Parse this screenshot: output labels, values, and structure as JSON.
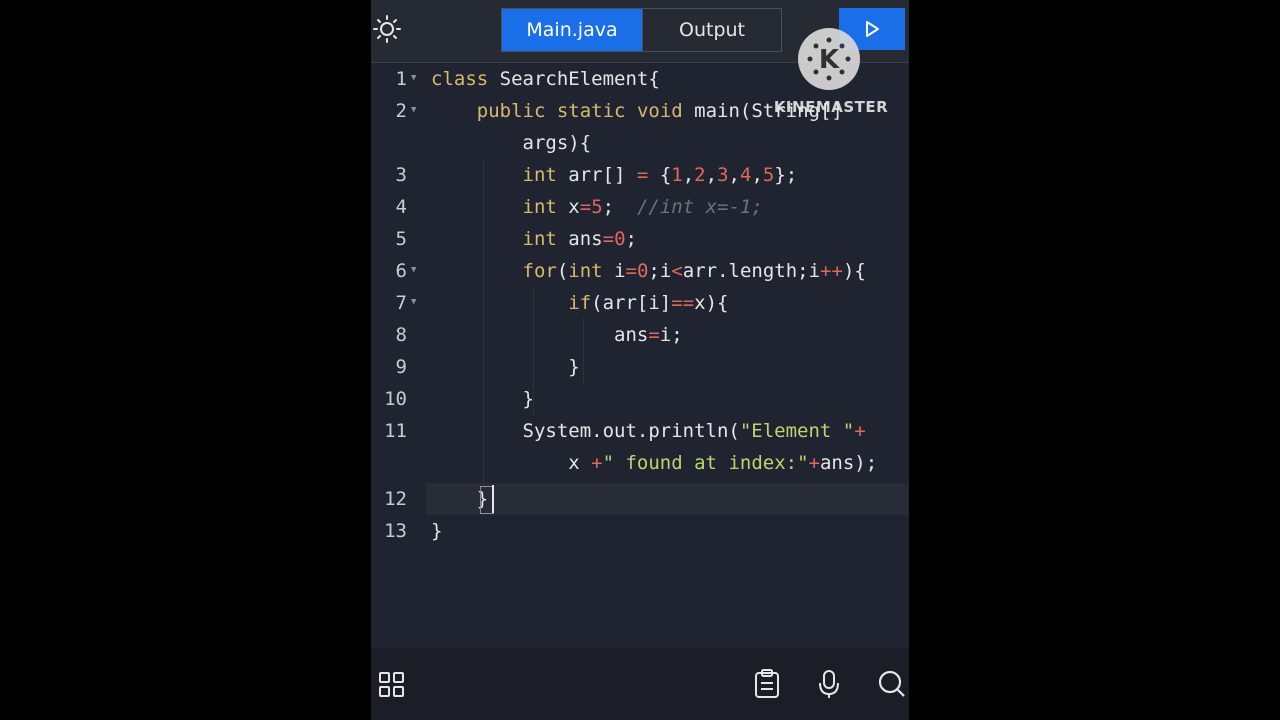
{
  "tabs": [
    {
      "label": "Main.java",
      "active": true
    },
    {
      "label": "Output",
      "active": false
    }
  ],
  "toolbar": {
    "theme_icon": "sun-icon",
    "run_icon": "play-icon"
  },
  "watermark": {
    "text": "KINEMASTER",
    "logo_letter": "K"
  },
  "editor": {
    "line_numbers": [
      "1",
      "2",
      "3",
      "4",
      "5",
      "6",
      "7",
      "8",
      "9",
      "10",
      "11",
      "12",
      "13"
    ],
    "lines": [
      "class SearchElement{",
      "    public static void main(String[]",
      "        args){",
      "        int arr[] = {1,2,3,4,5};",
      "        int x=5;  //int x=-1;",
      "        int ans=0;",
      "        for(int i=0;i<arr.length;i++){",
      "            if(arr[i]==x){",
      "                ans=i;",
      "            }",
      "        }",
      "        System.out.println(\"Element \"+",
      "            x +\" found at index:\"+ans);",
      "    }",
      "}"
    ],
    "active_line": "12"
  },
  "bottom_bar": {
    "icons": [
      "grid-icon",
      "clipboard-icon",
      "microphone-icon",
      "search-icon"
    ]
  },
  "colors": {
    "accent": "#1a6fe8",
    "editor_bg": "#1f2430",
    "keyword": "#d9b86a",
    "number": "#e0685a",
    "string": "#c5d06e",
    "comment": "#6b717d"
  }
}
